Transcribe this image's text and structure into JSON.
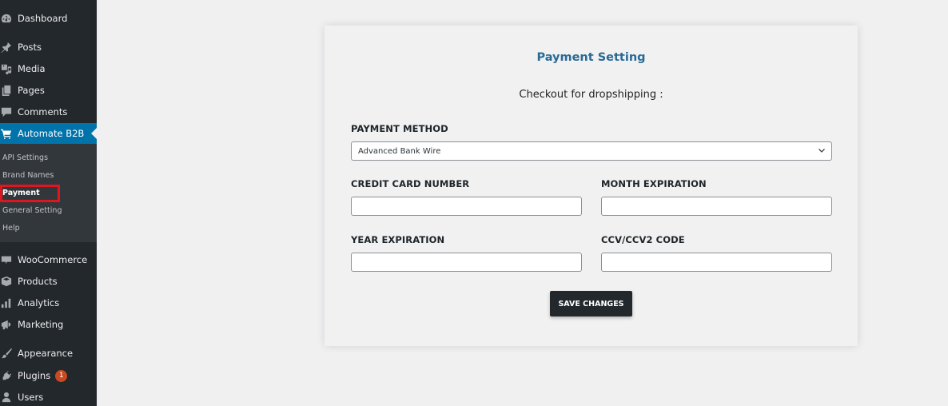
{
  "sidebar": {
    "items": [
      {
        "label": "Dashboard",
        "icon": "dashboard-icon"
      },
      {
        "label": "Posts",
        "icon": "pin-icon"
      },
      {
        "label": "Media",
        "icon": "media-icon"
      },
      {
        "label": "Pages",
        "icon": "pages-icon"
      },
      {
        "label": "Comments",
        "icon": "comment-icon"
      },
      {
        "label": "Automate B2B",
        "icon": "cart-icon",
        "active": true
      },
      {
        "label": "WooCommerce",
        "icon": "woo-icon"
      },
      {
        "label": "Products",
        "icon": "box-icon"
      },
      {
        "label": "Analytics",
        "icon": "bar-chart-icon"
      },
      {
        "label": "Marketing",
        "icon": "megaphone-icon"
      },
      {
        "label": "Appearance",
        "icon": "brush-icon"
      },
      {
        "label": "Plugins",
        "icon": "plug-icon",
        "badge": "1"
      },
      {
        "label": "Users",
        "icon": "user-icon"
      }
    ],
    "submenu": [
      {
        "label": "API Settings"
      },
      {
        "label": "Brand Names"
      },
      {
        "label": "Payment",
        "current": true
      },
      {
        "label": "General Setting"
      },
      {
        "label": "Help"
      }
    ]
  },
  "card": {
    "title": "Payment Setting",
    "subtitle": "Checkout for dropshipping :",
    "payment_method": {
      "label": "PAYMENT METHOD",
      "value": "Advanced Bank Wire"
    },
    "credit_card": {
      "label": "CREDIT CARD NUMBER",
      "value": ""
    },
    "month_expiration": {
      "label": "MONTH EXPIRATION",
      "value": ""
    },
    "year_expiration": {
      "label": "YEAR EXPIRATION",
      "value": ""
    },
    "ccv": {
      "label": "CCV/CCV2 CODE",
      "value": ""
    },
    "save_label": "SAVE CHANGES"
  },
  "colors": {
    "sidebar_bg": "#23282d",
    "active_bg": "#0073aa",
    "title": "#2a6a96",
    "highlight": "#e0161e",
    "badge": "#ca4a1f"
  }
}
